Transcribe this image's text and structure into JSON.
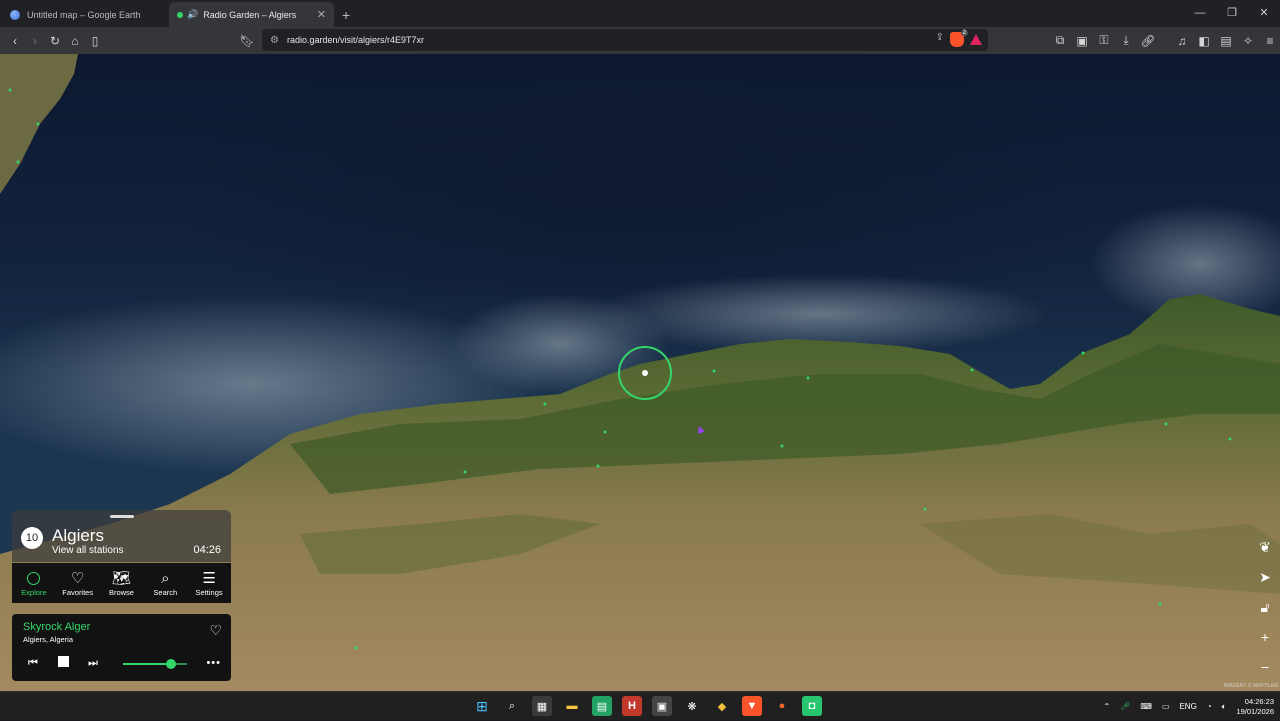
{
  "browser": {
    "tabs": [
      {
        "label": "Untitled map – Google Earth",
        "active": false
      },
      {
        "label": "Radio Garden – Algiers",
        "active": true
      }
    ],
    "url": "radio.garden/visit/algiers/r4E9T7xr",
    "brave_badge": "2"
  },
  "location_panel": {
    "station_count": "10",
    "name": "Algiers",
    "view_all": "View all stations",
    "local_time": "04:26"
  },
  "nav": {
    "items": [
      {
        "label": "Explore",
        "icon": "explore-circle-icon"
      },
      {
        "label": "Favorites",
        "icon": "heart-icon"
      },
      {
        "label": "Browse",
        "icon": "map-icon"
      },
      {
        "label": "Search",
        "icon": "search-icon"
      },
      {
        "label": "Settings",
        "icon": "menu-icon"
      }
    ]
  },
  "player": {
    "station": "Skyrock Alger",
    "place": "Algiers, Algeria",
    "volume": 0.75
  },
  "map": {
    "attribution": "IMAGERY © MAPTILER"
  },
  "taskbar": {
    "language": "ENG",
    "time": "04:26:23",
    "date": "19/01/2026"
  },
  "colors": {
    "accent": "#34d56a",
    "panel": "#121212"
  }
}
